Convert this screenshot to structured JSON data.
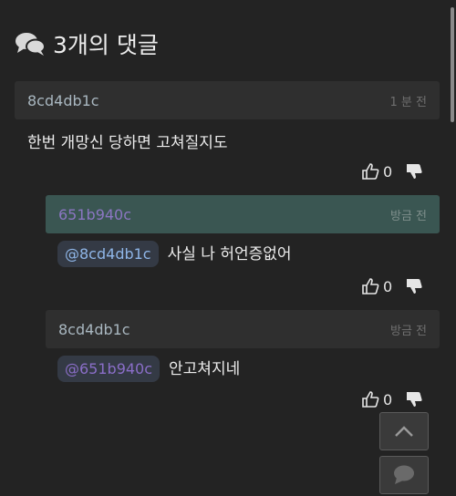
{
  "header": {
    "title": "3개의 댓글",
    "icon": "chat-bubbles-icon"
  },
  "comments": [
    {
      "author": "8cd4db1c",
      "time": "1 분 전",
      "mention": "",
      "text": "한번 개망신 당하면 고쳐질지도",
      "upvotes": "0"
    },
    {
      "author": "651b940c",
      "time": "방금 전",
      "mention": "@8cd4db1c",
      "text": "사실 나 허언증없어",
      "upvotes": "0"
    },
    {
      "author": "8cd4db1c",
      "time": "방금 전",
      "mention": "@651b940c",
      "text": "안고쳐지네",
      "upvotes": "0"
    }
  ],
  "buttons": {
    "scroll_top": "chevron-up-icon",
    "write_comment": "chat-bubble-icon"
  },
  "colors": {
    "background": "#232323",
    "bar": "#2f2f2f",
    "highlight_bar": "#3a5652",
    "mention_bg": "#343a45"
  }
}
